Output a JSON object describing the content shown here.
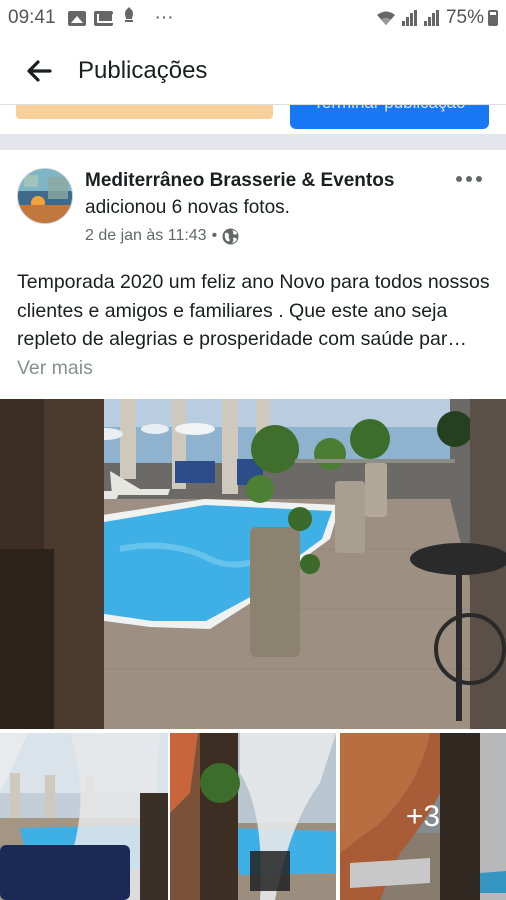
{
  "status_bar": {
    "time": "09:41",
    "dots": "···",
    "battery": "75%"
  },
  "header": {
    "title": "Publicações"
  },
  "composer": {
    "button_label": "Terminar publicação"
  },
  "post": {
    "page_name": "Mediterrâneo Brasserie & Eventos",
    "action": "adicionou 6 novas fotos.",
    "timestamp": "2 de jan às 11:43",
    "separator": "•",
    "text": "Temporada 2020 um feliz ano Novo para todos nossos clientes e amigos e familiares . Que este ano seja repleto de alegrias e prosperidade com saúde par…",
    "see_more": "Ver mais",
    "more_photos": "+3"
  },
  "colors": {
    "accent": "#1877f2",
    "secondary_text": "#65676b",
    "see_more": "#8a8d91",
    "pool": "#3fb0e6"
  },
  "icons": [
    "back-arrow-icon",
    "gallery-icon",
    "mail-icon",
    "notification-icon",
    "wifi-icon",
    "signal-icon",
    "battery-icon",
    "more-options-icon",
    "globe-icon"
  ]
}
